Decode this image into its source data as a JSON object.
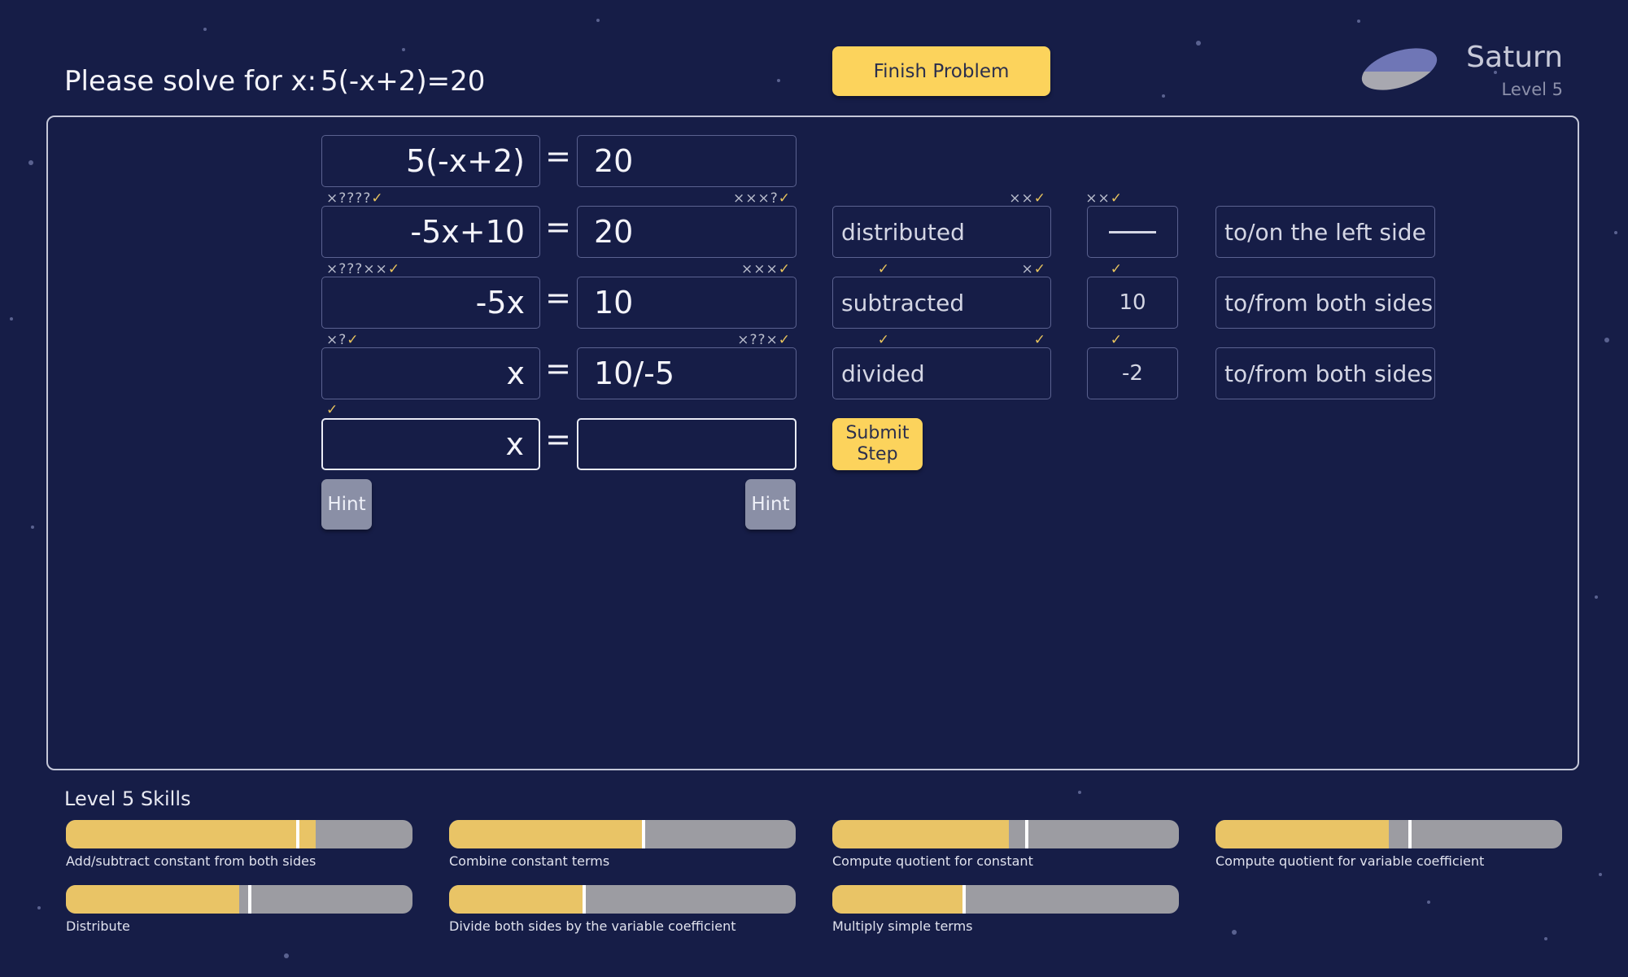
{
  "header": {
    "prompt": "Please solve for x:",
    "problem": "5(-x+2)=20",
    "finish_label": "Finish Problem"
  },
  "level": {
    "name": "Saturn",
    "label": "Level 5",
    "planet_icon": "saturn-planet-icon"
  },
  "steps": [
    {
      "lhs": "5(-x+2)",
      "eq": "=",
      "rhs": "20"
    },
    {
      "lhs": "-5x+10",
      "eq": "=",
      "rhs": "20",
      "lhs_marks": "×????",
      "rhs_marks": "×××?",
      "op": "distributed",
      "op_marks": "××",
      "num": "",
      "num_marks": "",
      "dir": "to/on the left side",
      "dir_marks": "××"
    },
    {
      "lhs": "-5x",
      "eq": "=",
      "rhs": "10",
      "lhs_marks": "×???××",
      "rhs_marks": "×××",
      "op": "subtracted",
      "op_marks": "×",
      "num": "10",
      "num_marks": "",
      "dir": "to/from both sides",
      "dir_marks": ""
    },
    {
      "lhs": "x",
      "eq": "=",
      "rhs": "10/-5",
      "lhs_marks": "×?",
      "rhs_marks": "×??×",
      "op": "divided",
      "op_marks": "",
      "num": "-2",
      "num_marks": "",
      "dir": "to/from both sides",
      "dir_marks": ""
    },
    {
      "lhs": "x",
      "eq": "=",
      "rhs": "",
      "lhs_marks": ""
    }
  ],
  "check_glyph": "✓",
  "controls": {
    "hint_left": "Hint",
    "hint_right": "Hint",
    "submit_line1": "Submit",
    "submit_line2": "Step"
  },
  "skills": {
    "title": "Level 5  Skills",
    "items": [
      {
        "name": "Add/subtract constant from both sides",
        "progress": 0.72,
        "mastery": 0.67
      },
      {
        "name": "Combine constant terms",
        "progress": 0.56,
        "mastery": 0.56
      },
      {
        "name": "Compute quotient for constant",
        "progress": 0.51,
        "mastery": 0.56
      },
      {
        "name": "Compute quotient for variable coefficient",
        "progress": 0.5,
        "mastery": 0.56
      },
      {
        "name": "Distribute",
        "progress": 0.5,
        "mastery": 0.53
      },
      {
        "name": "Divide both sides by the variable coefficient",
        "progress": 0.39,
        "mastery": 0.39
      },
      {
        "name": "Multiply simple terms",
        "progress": 0.38,
        "mastery": 0.38
      }
    ]
  },
  "colors": {
    "background": "#161d47",
    "accent": "#fcd35c",
    "bar_fill": "#e9c466",
    "bar_empty": "#9c9ca2",
    "check": "#e7c35d"
  }
}
